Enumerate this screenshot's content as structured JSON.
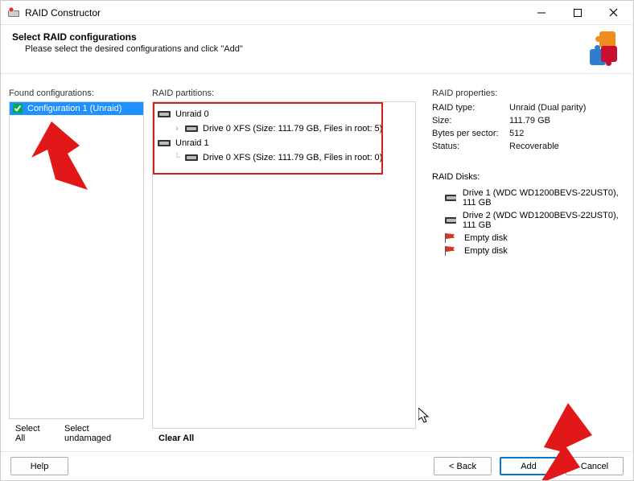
{
  "window": {
    "title": "RAID Constructor"
  },
  "header": {
    "title": "Select RAID configurations",
    "subtitle": "Please select the desired configurations and click \"Add\""
  },
  "columns": {
    "found_label": "Found configurations:",
    "partitions_label": "RAID partitions:",
    "properties_label": "RAID properties:"
  },
  "found_configs": [
    {
      "label": "Configuration 1 (Unraid)",
      "checked": true,
      "selected": true
    }
  ],
  "partitions": {
    "root0": "Unraid 0",
    "root0_child": "Drive 0 XFS (Size: 111.79 GB, Files in root: 5)",
    "root1": "Unraid 1",
    "root1_child": "Drive 0 XFS (Size: 111.79 GB, Files in root: 0)"
  },
  "properties": {
    "type_label": "RAID type:",
    "type_value": "Unraid (Dual parity)",
    "size_label": "Size:",
    "size_value": "111.79 GB",
    "bps_label": "Bytes per sector:",
    "bps_value": "512",
    "status_label": "Status:",
    "status_value": "Recoverable",
    "disks_label": "RAID Disks:",
    "disks": [
      {
        "kind": "disk",
        "text": "Drive 1 (WDC WD1200BEVS-22UST0), 111 GB"
      },
      {
        "kind": "disk",
        "text": "Drive 2 (WDC WD1200BEVS-22UST0), 111 GB"
      },
      {
        "kind": "empty",
        "text": "Empty disk"
      },
      {
        "kind": "empty",
        "text": "Empty disk"
      }
    ]
  },
  "actions": {
    "select_all": "Select All",
    "select_undamaged": "Select undamaged",
    "clear_all": "Clear All"
  },
  "footer": {
    "help": "Help",
    "back": "< Back",
    "add": "Add",
    "cancel": "Cancel"
  }
}
